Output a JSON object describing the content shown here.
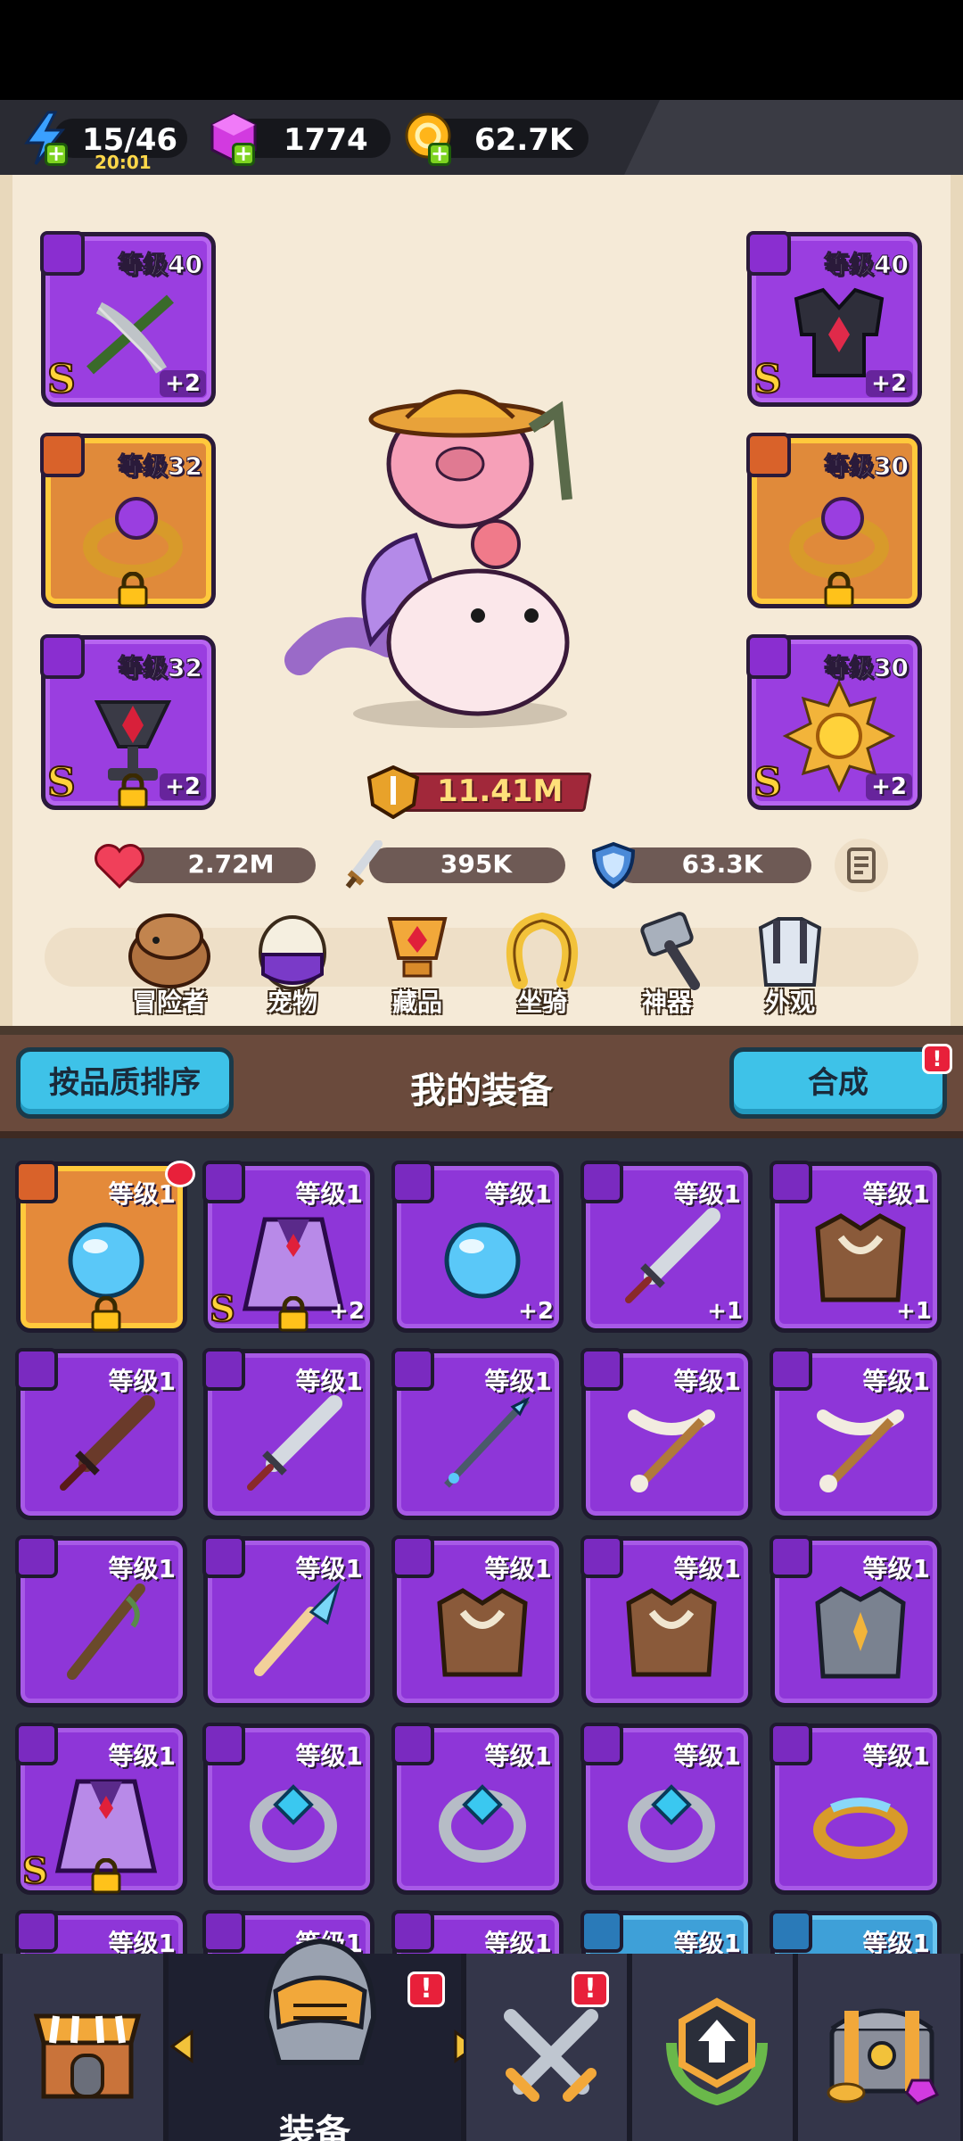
{
  "resources": {
    "energy": "15/46",
    "energy_timer": "20:01",
    "gems": "1774",
    "gold": "62.7K"
  },
  "left_slots": [
    {
      "level": "等级40",
      "plus": "+2",
      "grade": "S",
      "type": "weapon",
      "color": "purple",
      "locked": false
    },
    {
      "level": "等级32",
      "plus": "",
      "grade": "",
      "type": "ring",
      "color": "orange",
      "locked": true
    },
    {
      "level": "等级32",
      "plus": "+2",
      "grade": "S",
      "type": "necklace",
      "color": "purple",
      "locked": true
    }
  ],
  "right_slots": [
    {
      "level": "等级40",
      "plus": "+2",
      "grade": "S",
      "type": "armor",
      "color": "purple",
      "locked": false
    },
    {
      "level": "等级30",
      "plus": "",
      "grade": "",
      "type": "ring",
      "color": "orange",
      "locked": true
    },
    {
      "level": "等级30",
      "plus": "+2",
      "grade": "S",
      "type": "necklace",
      "color": "purple",
      "locked": false
    }
  ],
  "power": "11.41M",
  "stats": {
    "hp": "2.72M",
    "attack": "395K",
    "defense": "63.3K"
  },
  "menu": [
    "冒险者",
    "宠物",
    "藏品",
    "坐骑",
    "神器",
    "外观"
  ],
  "inventory": {
    "sort_button": "按品质排序",
    "title": "我的装备",
    "merge_button": "合成",
    "items": [
      {
        "level": "等级1",
        "plus": "",
        "grade": "",
        "color": "orange",
        "art": "orb",
        "locked": true,
        "new": true
      },
      {
        "level": "等级1",
        "plus": "+2",
        "grade": "S",
        "color": "purple",
        "art": "cape",
        "locked": true,
        "new": false
      },
      {
        "level": "等级1",
        "plus": "+2",
        "grade": "",
        "color": "purple",
        "art": "orb",
        "locked": false,
        "new": false
      },
      {
        "level": "等级1",
        "plus": "+1",
        "grade": "",
        "color": "purple",
        "art": "sword",
        "locked": false,
        "new": false
      },
      {
        "level": "等级1",
        "plus": "+1",
        "grade": "",
        "color": "purple",
        "art": "armor",
        "locked": false,
        "new": false
      },
      {
        "level": "等级1",
        "plus": "",
        "grade": "",
        "color": "purple",
        "art": "sword-dark",
        "locked": false,
        "new": false
      },
      {
        "level": "等级1",
        "plus": "",
        "grade": "",
        "color": "purple",
        "art": "sword",
        "locked": false,
        "new": false
      },
      {
        "level": "等级1",
        "plus": "",
        "grade": "",
        "color": "purple",
        "art": "spear",
        "locked": false,
        "new": false
      },
      {
        "level": "等级1",
        "plus": "",
        "grade": "",
        "color": "purple",
        "art": "bow",
        "locked": false,
        "new": false
      },
      {
        "level": "等级1",
        "plus": "",
        "grade": "",
        "color": "purple",
        "art": "bow",
        "locked": false,
        "new": false
      },
      {
        "level": "等级1",
        "plus": "",
        "grade": "",
        "color": "purple",
        "art": "staff",
        "locked": false,
        "new": false
      },
      {
        "level": "等级1",
        "plus": "",
        "grade": "",
        "color": "purple",
        "art": "wand",
        "locked": false,
        "new": false
      },
      {
        "level": "等级1",
        "plus": "",
        "grade": "",
        "color": "purple",
        "art": "armor",
        "locked": false,
        "new": false
      },
      {
        "level": "等级1",
        "plus": "",
        "grade": "",
        "color": "purple",
        "art": "armor",
        "locked": false,
        "new": false
      },
      {
        "level": "等级1",
        "plus": "",
        "grade": "",
        "color": "purple",
        "art": "plate",
        "locked": false,
        "new": false
      },
      {
        "level": "等级1",
        "plus": "",
        "grade": "S",
        "color": "purple",
        "art": "cape",
        "locked": true,
        "new": false
      },
      {
        "level": "等级1",
        "plus": "",
        "grade": "",
        "color": "purple",
        "art": "ring-gem",
        "locked": false,
        "new": false
      },
      {
        "level": "等级1",
        "plus": "",
        "grade": "",
        "color": "purple",
        "art": "ring-gem",
        "locked": false,
        "new": false
      },
      {
        "level": "等级1",
        "plus": "",
        "grade": "",
        "color": "purple",
        "art": "ring-gem",
        "locked": false,
        "new": false
      },
      {
        "level": "等级1",
        "plus": "",
        "grade": "",
        "color": "purple",
        "art": "ring-gold",
        "locked": false,
        "new": false
      },
      {
        "level": "等级1",
        "plus": "",
        "grade": "",
        "color": "purple",
        "art": "none",
        "locked": false,
        "new": false
      },
      {
        "level": "等级1",
        "plus": "",
        "grade": "",
        "color": "purple",
        "art": "none",
        "locked": false,
        "new": false
      },
      {
        "level": "等级1",
        "plus": "",
        "grade": "",
        "color": "purple",
        "art": "none",
        "locked": false,
        "new": false
      },
      {
        "level": "等级1",
        "plus": "",
        "grade": "",
        "color": "blue",
        "art": "none",
        "locked": false,
        "new": false
      },
      {
        "level": "等级1",
        "plus": "",
        "grade": "",
        "color": "blue",
        "art": "none",
        "locked": false,
        "new": false
      }
    ]
  },
  "bottom_nav": {
    "active_label": "装备",
    "tabs": [
      "shop-icon",
      "equipment-helmet-icon",
      "battle-swords-icon",
      "upgrade-icon",
      "treasure-chest-icon"
    ],
    "alerts": [
      "!",
      "!"
    ]
  },
  "colors": {
    "purple_slot": "#9a3ee0",
    "orange_slot": "#e08a3a",
    "panel_bg": "#f5ead7",
    "button_cyan": "#3ec2e8",
    "alert_red": "#e8203a"
  }
}
